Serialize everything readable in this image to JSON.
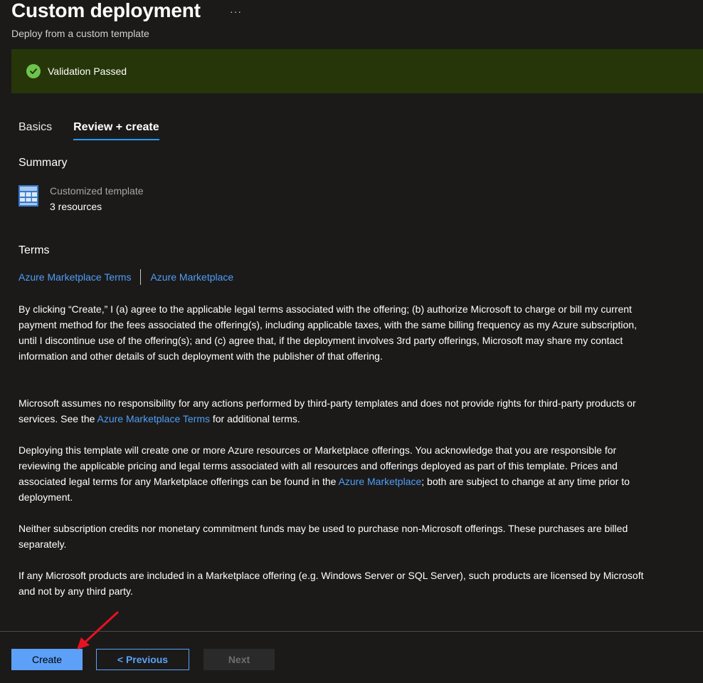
{
  "header": {
    "title": "Custom deployment",
    "more_label": "···",
    "subtitle": "Deploy from a custom template"
  },
  "banner": {
    "icon": "check-circle-icon",
    "message": "Validation Passed",
    "color": "#263608"
  },
  "tabs": [
    {
      "label": "Basics",
      "active": false
    },
    {
      "label": "Review + create",
      "active": true
    }
  ],
  "summary": {
    "heading": "Summary",
    "template_icon": "template-grid-icon",
    "template_name": "Customized template",
    "resource_count": "3 resources"
  },
  "terms": {
    "heading": "Terms",
    "links": [
      "Azure Marketplace Terms",
      "Azure Marketplace"
    ],
    "paragraph1": "By clicking “Create,” I (a) agree to the applicable legal terms associated with the offering; (b) authorize Microsoft to charge or bill my current payment method for the fees associated the offering(s), including applicable taxes, with the same billing frequency as my Azure subscription, until I discontinue use of the offering(s); and (c) agree that, if the deployment involves 3rd party offerings, Microsoft may share my contact information and other details of such deployment with the publisher of that offering.",
    "paragraph2_before": "Microsoft assumes no responsibility for any actions performed by third-party templates and does not provide rights for third-party products or services. See the ",
    "paragraph2_link": "Azure Marketplace Terms",
    "paragraph2_after": " for additional terms.",
    "paragraph3_before": "Deploying this template will create one or more Azure resources or Marketplace offerings.  You acknowledge that you are responsible for reviewing the applicable pricing and legal terms associated with all resources and offerings deployed as part of this template.  Prices and associated legal terms for any Marketplace offerings can be found in the ",
    "paragraph3_link": "Azure Marketplace",
    "paragraph3_after": "; both are subject to change at any time prior to deployment.",
    "paragraph4": "Neither subscription credits nor monetary commitment funds may be used to purchase non-Microsoft offerings. These purchases are billed separately.",
    "paragraph5": "If any Microsoft products are included in a Marketplace offering (e.g. Windows Server or SQL Server), such products are licensed by Microsoft and not by any third party."
  },
  "footer": {
    "create_label": "Create",
    "previous_label": "< Previous",
    "next_label": "Next"
  },
  "colors": {
    "background": "#1b1a19",
    "accent": "#5ca0f8",
    "link": "#4f9ef8",
    "annotation_arrow": "#e81123"
  }
}
